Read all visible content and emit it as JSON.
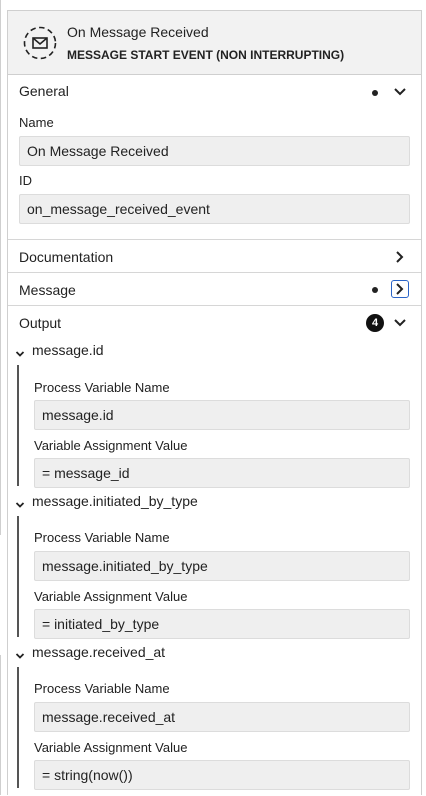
{
  "header": {
    "title": "On Message Received",
    "subtitle": "MESSAGE START EVENT (NON INTERRUPTING)",
    "icon": "message-start-event-icon"
  },
  "general": {
    "title": "General",
    "name_label": "Name",
    "name_value": "On Message Received",
    "id_label": "ID",
    "id_value": "on_message_received_event"
  },
  "documentation": {
    "title": "Documentation"
  },
  "message": {
    "title": "Message"
  },
  "output": {
    "title": "Output",
    "count": "4",
    "entries": [
      {
        "title": "message.id",
        "var_label": "Process Variable Name",
        "var_value": "message.id",
        "assign_label": "Variable Assignment Value",
        "assign_value": "= message_id"
      },
      {
        "title": "message.initiated_by_type",
        "var_label": "Process Variable Name",
        "var_value": "message.initiated_by_type",
        "assign_label": "Variable Assignment Value",
        "assign_value": "= initiated_by_type"
      },
      {
        "title": "message.received_at",
        "var_label": "Process Variable Name",
        "var_value": "message.received_at",
        "assign_label": "Variable Assignment Value",
        "assign_value": "= string(now())"
      }
    ]
  },
  "colors": {
    "focus_border": "#2a64c8",
    "header_bg": "#f2f2f2",
    "input_bg": "#efefef"
  }
}
